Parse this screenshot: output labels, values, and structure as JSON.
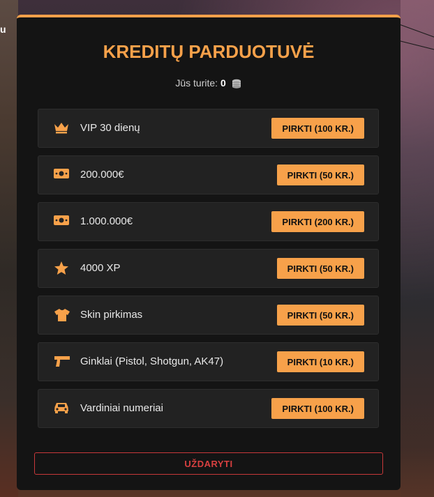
{
  "background": {
    "left_text": "u"
  },
  "shop": {
    "title": "KREDITŲ PARDUOTUVĖ",
    "balance_label": "Jūs turite:",
    "balance_value": "0",
    "items": [
      {
        "icon": "crown-icon",
        "label": "VIP 30 dienų",
        "button": "PIRKTI (100 KR.)"
      },
      {
        "icon": "money-icon",
        "label": "200.000€",
        "button": "PIRKTI (50 KR.)"
      },
      {
        "icon": "money-icon",
        "label": "1.000.000€",
        "button": "PIRKTI (200 KR.)"
      },
      {
        "icon": "star-icon",
        "label": "4000 XP",
        "button": "PIRKTI (50 KR.)"
      },
      {
        "icon": "shirt-icon",
        "label": "Skin pirkimas",
        "button": "PIRKTI (50 KR.)"
      },
      {
        "icon": "gun-icon",
        "label": "Ginklai (Pistol, Shotgun, AK47)",
        "button": "PIRKTI (10 KR.)"
      },
      {
        "icon": "car-icon",
        "label": "Vardiniai numeriai",
        "button": "PIRKTI (100 KR.)"
      }
    ],
    "close_label": "UŽDARYTI"
  },
  "colors": {
    "accent": "#f7a14a",
    "danger": "#d84040",
    "panel": "#141414",
    "row": "#222222"
  }
}
